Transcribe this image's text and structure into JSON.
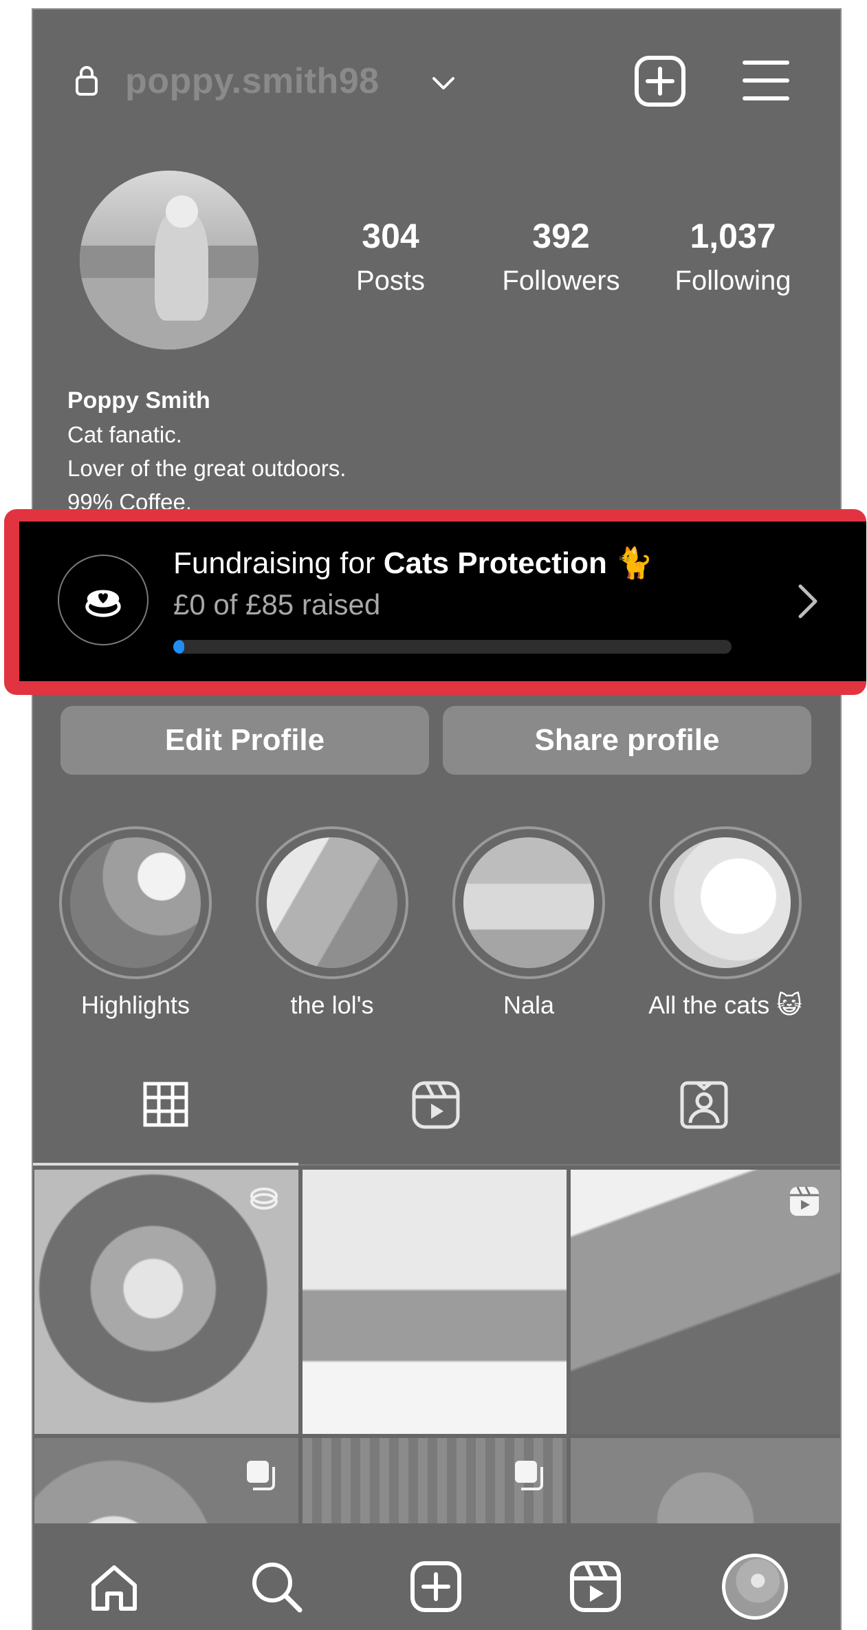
{
  "header": {
    "username": "poppy.smith98",
    "icons": [
      "lock-icon",
      "chevron-down-icon",
      "new-post-icon",
      "menu-icon"
    ]
  },
  "profile": {
    "stats": [
      {
        "value": "304",
        "label": "Posts"
      },
      {
        "value": "392",
        "label": "Followers"
      },
      {
        "value": "1,037",
        "label": "Following"
      }
    ],
    "name": "Poppy Smith",
    "bio": [
      "Cat fanatic.",
      "Lover of the great outdoors.",
      "99% Coffee."
    ]
  },
  "fundraiser": {
    "prefix": "Fundraising for ",
    "charity": "Cats Protection",
    "emoji": "🐈",
    "raised": "£0 of £85 raised",
    "progress_fraction": 0.0,
    "highlight_color": "#e23340",
    "progress_color": "#1f8ff5"
  },
  "buttons": {
    "edit": "Edit Profile",
    "share": "Share profile"
  },
  "highlights": [
    {
      "label": "Highlights"
    },
    {
      "label": "the lol's"
    },
    {
      "label": "Nala"
    },
    {
      "label": "All the cats 😺"
    }
  ],
  "tabs": [
    "grid-icon",
    "reels-icon",
    "tagged-icon"
  ],
  "nav": [
    "home-icon",
    "search-icon",
    "create-icon",
    "reels-icon",
    "profile-avatar"
  ]
}
